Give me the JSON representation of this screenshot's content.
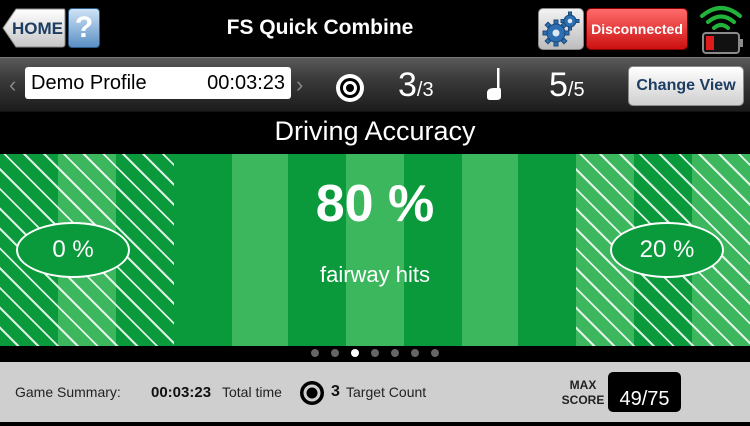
{
  "header": {
    "home_label": "HOME",
    "help_label": "?",
    "title": "FS Quick Combine",
    "settings_icon": "gears-icon",
    "connection_label": "Disconnected",
    "wifi_icon": "wifi-icon",
    "battery_icon": "battery-low-icon"
  },
  "profile_bar": {
    "profile_name": "Demo Profile",
    "elapsed": "00:03:23",
    "targets_done": "3",
    "targets_total": "/3",
    "shots_done": "5",
    "shots_total": "/5",
    "change_view_label": "Change View"
  },
  "panel": {
    "title": "Driving Accuracy",
    "fairway_pct": "80 %",
    "fairway_label": "fairway hits",
    "left_miss_pct": "0 %",
    "right_miss_pct": "20 %"
  },
  "pager": {
    "count": 7,
    "active_index": 2
  },
  "summary": {
    "label": "Game Summary:",
    "total_time": "00:03:23",
    "total_time_label": "Total time",
    "target_count": "3",
    "target_count_label": "Target Count",
    "max_score_label_1": "MAX",
    "max_score_label_2": "SCORE",
    "max_score": "49/75"
  },
  "colors": {
    "fairway_dark": "#0a9a3c",
    "fairway_light": "#3cb75e",
    "disconnected": "#e02020",
    "summary_bg": "#cfcfcf"
  }
}
